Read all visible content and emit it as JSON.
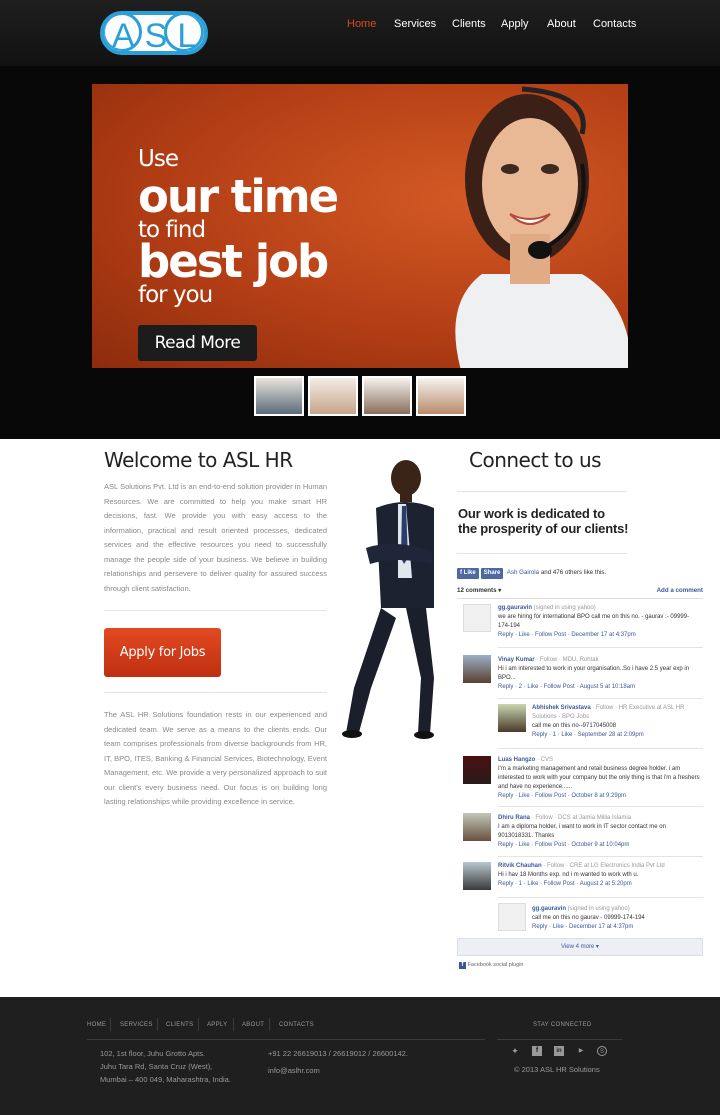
{
  "brand": {
    "logo_text": "ASL"
  },
  "nav": {
    "items": [
      "Home",
      "Services",
      "Clients",
      "Apply",
      "About",
      "Contacts"
    ],
    "active": "Home"
  },
  "hero": {
    "line1": "Use",
    "line2": "our time",
    "line3": "to find",
    "line4": "best job",
    "line5": "for you",
    "cta": "Read More"
  },
  "welcome": {
    "title": "Welcome to ASL HR",
    "para1": "ASL Solutions Pvt. Ltd is an end-to-end solution provider in Human Resources. We are committed to help you make smart HR decisions, fast. We provide you with easy access to the information, practical and result oriented processes, dedicated services and the effective resources you need to successfully manage the people side of your business. We believe in building relationships and persevere to deliver quality for assured success through client satisfaction.",
    "apply_btn": "Apply for Jobs",
    "para2": "The ASL HR Solutions foundation rests in our experienced and dedicated team. We serve as a means to the clients ends. Our team comprises professionals from diverse backgrounds from HR, IT, BPO, ITES, Banking & Financial Services, Biotechnology, Event Management, etc. We provide a very personalized approach to suit our client's every business need. Our focus is on building long lasting relationships while providing excellence in service."
  },
  "connect": {
    "title": "Connect to us",
    "tagline1": "Our work is dedicated to",
    "tagline2": "the prosperity of our clients!",
    "like_btn": "Like",
    "share_btn": "Share",
    "like_text_name": "Ash Gairola",
    "like_text_rest": " and 476 others like this.",
    "comments_count": "12 comments ▾",
    "add_comment": "Add a comment",
    "view_more": "View 4 more ▾",
    "plugin_label": "Facebook social plugin",
    "comments": [
      {
        "name": "gg.gauravin",
        "meta": " (signed in using yahoo)",
        "text": "we are hiring for international BPO call me on this no. - gaurav :- 09999-174-194",
        "actions": "Reply · Like · Follow Post · December 17 at 4:37pm"
      },
      {
        "name": "Vinay Kumar",
        "meta": " · Follow · MDU, Rohtak",
        "text": "Hi i am interested to work in your organisation..So i have 2.5 year exp in BPO...",
        "actions": "Reply · 2 · Like · Follow Post · August 5 at 10:18am"
      },
      {
        "name": "Abhishek Srivastava",
        "meta": " · Follow · HR Executive at ASL HR Solutions - BPO Jobs",
        "text": "call me on this no--9717045008",
        "actions": "Reply · 1 · Like · September 28 at 2:09pm"
      },
      {
        "name": "Luas Hangzo",
        "meta": " · CVS",
        "text": "I'm a marketing management and retail business degree holder. i am interested to work with your company but the only thing is that i'm a freshers and have no experience......",
        "actions": "Reply · Like · Follow Post · October 8 at 9:29pm"
      },
      {
        "name": "Dhiru Rana",
        "meta": " · Follow · DCS at Jamia Millia Islamia",
        "text": "I am a diploma holder, i want to work in IT sector contact me on 9013018331. Thanks",
        "actions": "Reply · Like · Follow Post · October 9 at 10:04pm"
      },
      {
        "name": "Ritvik Chauhan",
        "meta": " · Follow · CRE at LG Electronics India Pvt Ltd",
        "text": "Hi i hav 18 Months exp. nd i m wanted to work wth u.",
        "actions": "Reply · 1 · Like · Follow Post · August 2 at 5:20pm"
      },
      {
        "name": "gg.gauravin",
        "meta": " (signed in using yahoo)",
        "text": "call me on this no gaurav - 09999-174-194",
        "actions": "Reply · Like · December 17 at 4:37pm"
      }
    ]
  },
  "footer": {
    "nav": [
      "HOME",
      "SERVICES",
      "CLIENTS",
      "APPLY",
      "ABOUT",
      "CONTACTS"
    ],
    "address": [
      "102, 1st floor, Juhu Grotto Apts.",
      "Juhu Tara Rd, Santa Cruz (West),",
      "Mumbai – 400 049, Maharashtra, India."
    ],
    "phone": "+91 22 26619013 / 26619012 / 26600142.",
    "email": "info@aslhr.com",
    "stay_connected": "STAY CONNECTED",
    "copyright": "© 2013 ASL HR Solutions",
    "social_icons": [
      "twitter-icon",
      "facebook-icon",
      "linkedin-icon",
      "youtube-icon",
      "skype-icon"
    ]
  },
  "colors": {
    "accent": "#d84a1b",
    "logo_blue": "#2ba0d8",
    "fb_blue": "#3b5998",
    "footer_bg": "#1f1f1f"
  }
}
